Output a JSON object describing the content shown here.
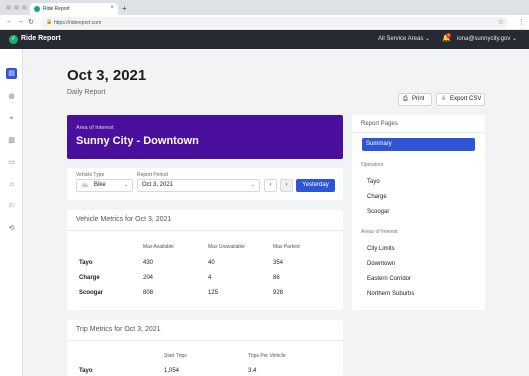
{
  "browser": {
    "tab_title": "Ride Report",
    "tab_close": "×",
    "new_tab": "+",
    "url": "https://ridereport.com",
    "back": "←",
    "forward": "→",
    "reload": "↻",
    "lock": "🔒",
    "star": "☆",
    "menu": "⋮"
  },
  "header": {
    "brand": "Ride Report",
    "logo_glyph": "✓",
    "service_areas": "All Service Areas",
    "notification_count": "1",
    "user": "iona@sunnycity.gov"
  },
  "sidebar": {
    "items": [
      {
        "icon": "report-icon",
        "glyph": "▤"
      },
      {
        "icon": "globe-icon",
        "glyph": "◍"
      },
      {
        "icon": "pin-icon",
        "glyph": "⌖"
      },
      {
        "icon": "chart-icon",
        "glyph": "▥"
      },
      {
        "icon": "document-icon",
        "glyph": "▭"
      },
      {
        "icon": "building-icon",
        "glyph": "⌂"
      },
      {
        "icon": "flag-icon",
        "glyph": "⚐"
      },
      {
        "icon": "route-icon",
        "glyph": "⟲"
      }
    ]
  },
  "page": {
    "title": "Oct 3, 2021",
    "subtitle": "Daily Report",
    "print_label": "Print",
    "export_label": "Export CSV"
  },
  "area_of_interest": {
    "label": "Area of Interest",
    "value": "Sunny City - Downtown"
  },
  "filters": {
    "vehicle_type_label": "Vehicle Type",
    "vehicle_type_value": "Bike",
    "report_period_label": "Report Period",
    "report_period_value": "Oct 3, 2021",
    "prev": "‹",
    "next": "›",
    "yesterday_label": "Yesterday"
  },
  "vehicle_metrics": {
    "title": "Vehicle Metrics for Oct 3, 2021",
    "columns": [
      "Max Available",
      "Max Unavailable",
      "Max Parked"
    ],
    "rows": [
      {
        "operator": "Tayo",
        "values": [
          "430",
          "40",
          "354"
        ]
      },
      {
        "operator": "Charge",
        "values": [
          "204",
          "4",
          "86"
        ]
      },
      {
        "operator": "Scoogar",
        "values": [
          "808",
          "125",
          "928"
        ]
      }
    ]
  },
  "trip_metrics": {
    "title": "Trip Metrics for Oct 3, 2021",
    "columns": [
      "Start Trips",
      "Trips Per Vehicle"
    ],
    "rows": [
      {
        "operator": "Tayo",
        "values": [
          "1,054",
          "3.4"
        ]
      }
    ]
  },
  "report_pages": {
    "title": "Report Pages",
    "active": "Summary",
    "operators_label": "Operators",
    "operators": [
      "Tayo",
      "Charge",
      "Scoogar"
    ],
    "areas_label": "Areas of Interest",
    "areas": [
      "City Limits",
      "Downtown",
      "Eastern Corridor",
      "Northern Suburbs"
    ]
  }
}
